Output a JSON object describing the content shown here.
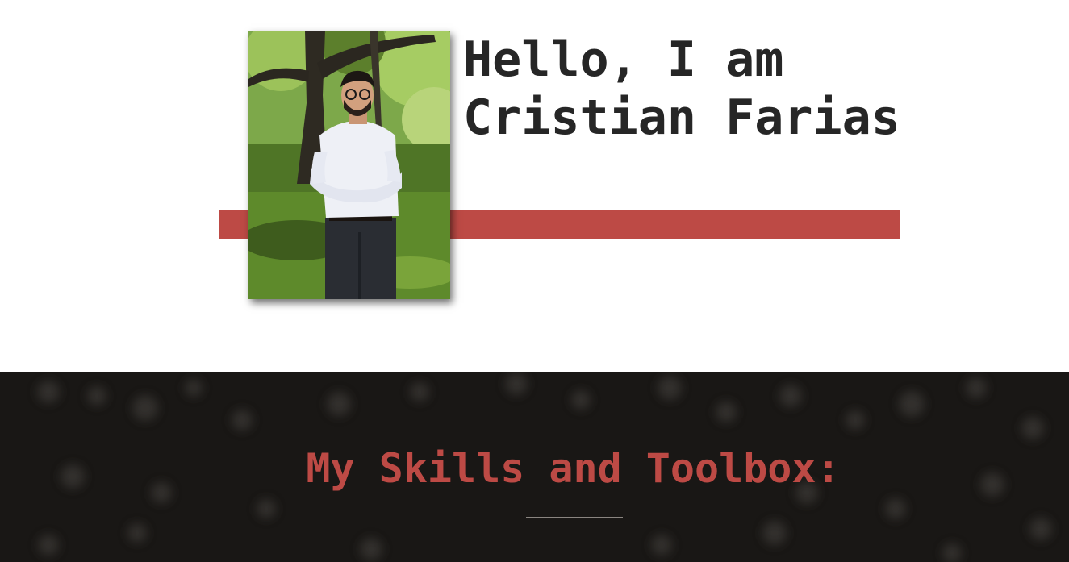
{
  "hero": {
    "title_line1": "Hello, I am",
    "title_line2": "Cristian Farias",
    "accent_color": "#bd4a45",
    "portrait": "photo-of-person-in-park"
  },
  "skills": {
    "heading": "My Skills and Toolbox:",
    "heading_color": "#bd4a45",
    "background_color": "#191715"
  }
}
